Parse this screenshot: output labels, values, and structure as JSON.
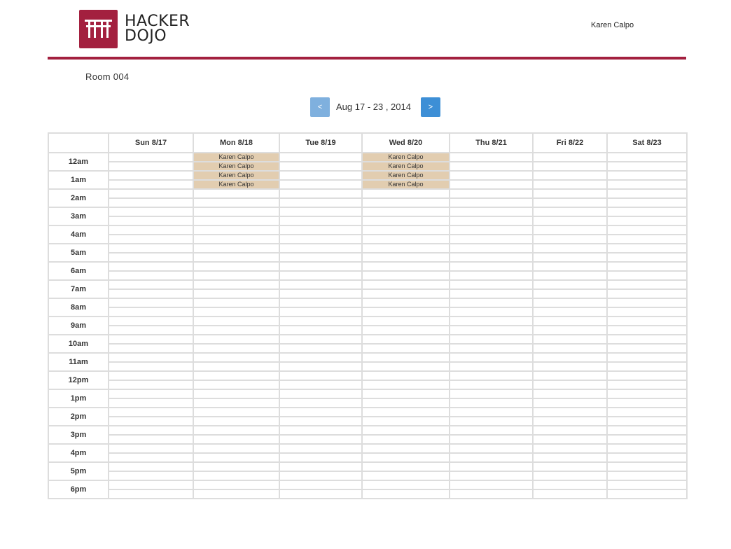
{
  "header": {
    "logo_line1": "HACKER",
    "logo_line2": "DOJO",
    "user_name": "Karen Calpo",
    "brand_color": "#a3203f"
  },
  "room": {
    "name": "Room 004"
  },
  "nav": {
    "prev_label": "<",
    "next_label": ">",
    "range_label": "Aug 17 - 23 , 2014"
  },
  "calendar": {
    "days": [
      "Sun 8/17",
      "Mon 8/18",
      "Tue 8/19",
      "Wed 8/20",
      "Thu 8/21",
      "Fri 8/22",
      "Sat 8/23"
    ],
    "hours": [
      "12am",
      "1am",
      "2am",
      "3am",
      "4am",
      "5am",
      "6am",
      "7am",
      "8am",
      "9am",
      "10am",
      "11am",
      "12pm",
      "1pm",
      "2pm",
      "3pm",
      "4pm",
      "5pm",
      "6pm"
    ],
    "bookings": [
      {
        "day": 1,
        "slot": 0,
        "label": "Karen Calpo"
      },
      {
        "day": 1,
        "slot": 1,
        "label": "Karen Calpo"
      },
      {
        "day": 1,
        "slot": 2,
        "label": "Karen Calpo"
      },
      {
        "day": 1,
        "slot": 3,
        "label": "Karen Calpo"
      },
      {
        "day": 3,
        "slot": 0,
        "label": "Karen Calpo"
      },
      {
        "day": 3,
        "slot": 1,
        "label": "Karen Calpo"
      },
      {
        "day": 3,
        "slot": 2,
        "label": "Karen Calpo"
      },
      {
        "day": 3,
        "slot": 3,
        "label": "Karen Calpo"
      }
    ],
    "booking_color": "#e2cdb0"
  }
}
